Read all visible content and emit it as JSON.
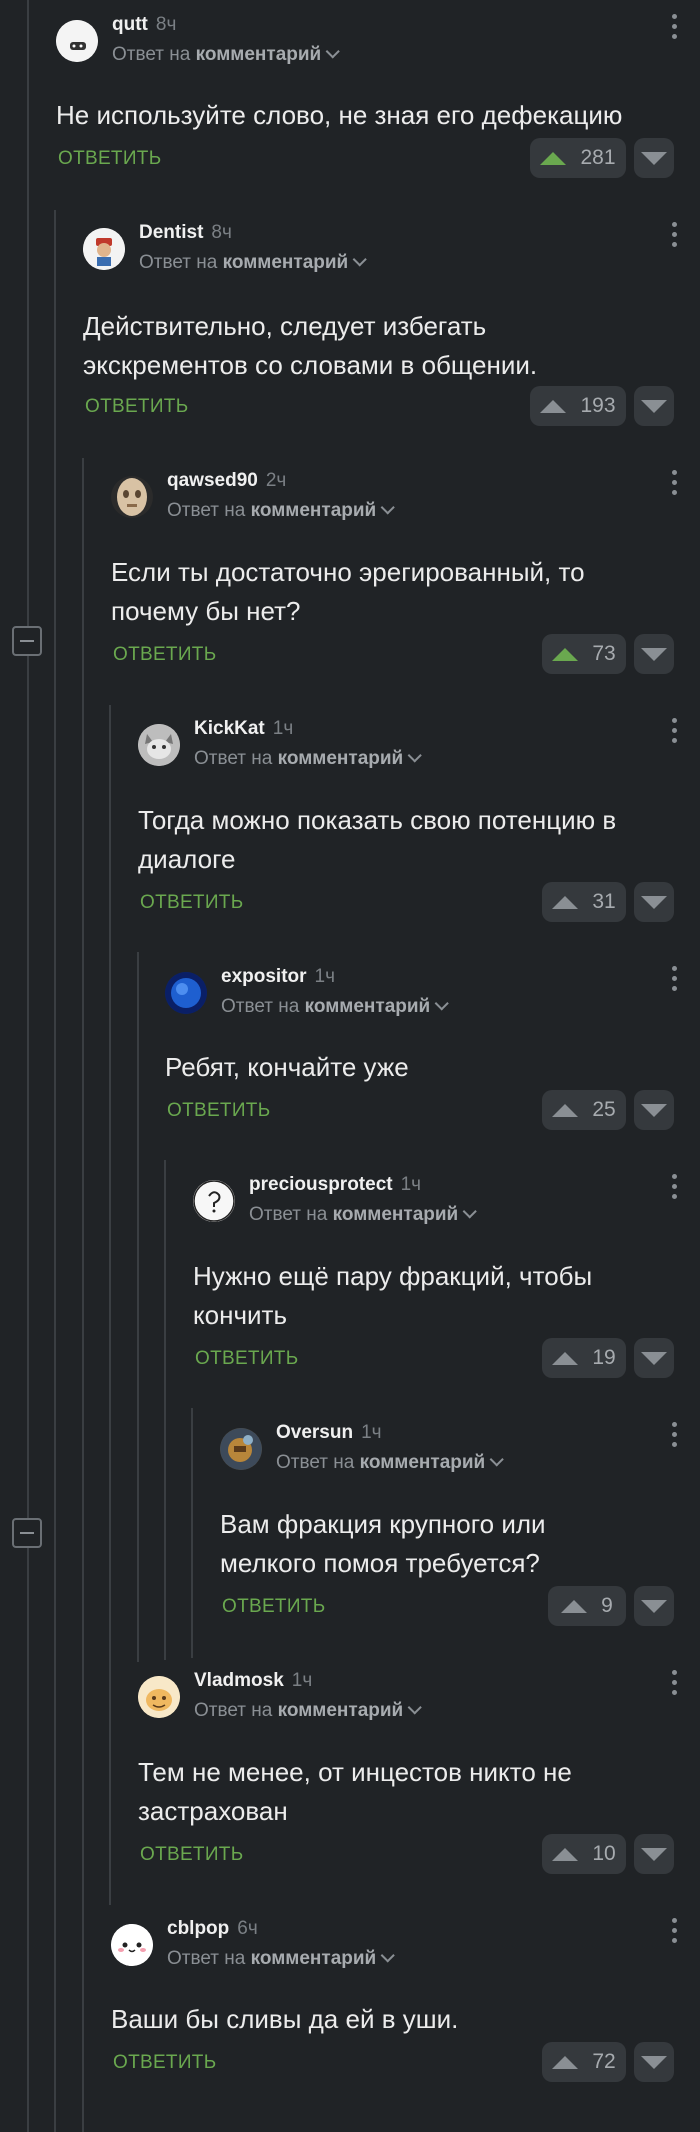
{
  "reply_label": "ОТВЕТИТЬ",
  "reply_to_prefix": "Ответ на",
  "reply_to_link": "комментарий",
  "comments": [
    {
      "user": "qutt",
      "time": "8ч",
      "text": "Не используйте слово, не зная его дефекацию",
      "votes": "281",
      "upvoted": true
    },
    {
      "user": "Dentist",
      "time": "8ч",
      "text": "Действительно, следует избегать экскрементов со словами в общении.",
      "votes": "193",
      "upvoted": false
    },
    {
      "user": "qawsed90",
      "time": "2ч",
      "text": "Если ты достаточно эрегированный, то почему бы нет?",
      "votes": "73",
      "upvoted": true
    },
    {
      "user": "KickKat",
      "time": "1ч",
      "text": "Тогда можно показать свою потенцию в диалоге",
      "votes": "31",
      "upvoted": false
    },
    {
      "user": "expositor",
      "time": "1ч",
      "text": "Ребят, кончайте уже",
      "votes": "25",
      "upvoted": false
    },
    {
      "user": "preciousprotect",
      "time": "1ч",
      "text": "Нужно ещё пару фракций, чтобы кончить",
      "votes": "19",
      "upvoted": false
    },
    {
      "user": "Oversun",
      "time": "1ч",
      "text": "Вам фракция крупного или мелкого помоя требуется?",
      "votes": "9",
      "upvoted": false
    },
    {
      "user": "Vladmosk",
      "time": "1ч",
      "text": "Тем не менее, от инцестов никто не застрахован",
      "votes": "10",
      "upvoted": false
    },
    {
      "user": "cblpop",
      "time": "6ч",
      "text": "Ваши бы сливы да ей в уши.",
      "votes": "72",
      "upvoted": false
    }
  ],
  "colors": {
    "accent_green": "#6aa84f",
    "background": "#202326"
  }
}
